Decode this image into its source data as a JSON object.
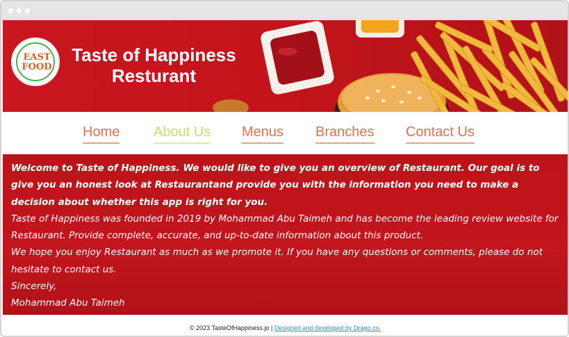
{
  "hero": {
    "title_line1": "Taste of Happiness",
    "title_line2": "Resturant",
    "logo_text_top": "EAST",
    "logo_text_bottom": "FOOD"
  },
  "nav": {
    "items": [
      {
        "label": "Home",
        "active": false
      },
      {
        "label": "About Us",
        "active": true
      },
      {
        "label": "Menus",
        "active": false
      },
      {
        "label": "Branches",
        "active": false
      },
      {
        "label": "Contact Us",
        "active": false
      }
    ]
  },
  "content": {
    "welcome": "Welcome to Taste of Happiness. We would like to give you an overview of Restaurant. Our goal is to give you an honest look at Restaurantand provide you with the information you need to make a decision about whether this app is right for you.",
    "founded": "Taste of Happiness was founded in 2019 by Mohammad Abu Taimeh and has become the leading review website for Restaurant. Provide complete, accurate, and up-to-date information about this product.",
    "hope": "We hope you enjoy Restaurant as much as we promote it. If you have any questions or comments, please do not hesitate to contact us.",
    "closing": "Sincerely,",
    "signature": "Mohammad Abu Taimeh"
  },
  "footer": {
    "copyright": "© 2023 TasteOfHappiness.jo |",
    "credit_link": "Designed and developed by Drago co."
  },
  "colors": {
    "brand_red": "#c4141b",
    "nav_link": "#e8704a",
    "nav_active": "#c3e06a",
    "footer_link": "#2b8fd6"
  }
}
